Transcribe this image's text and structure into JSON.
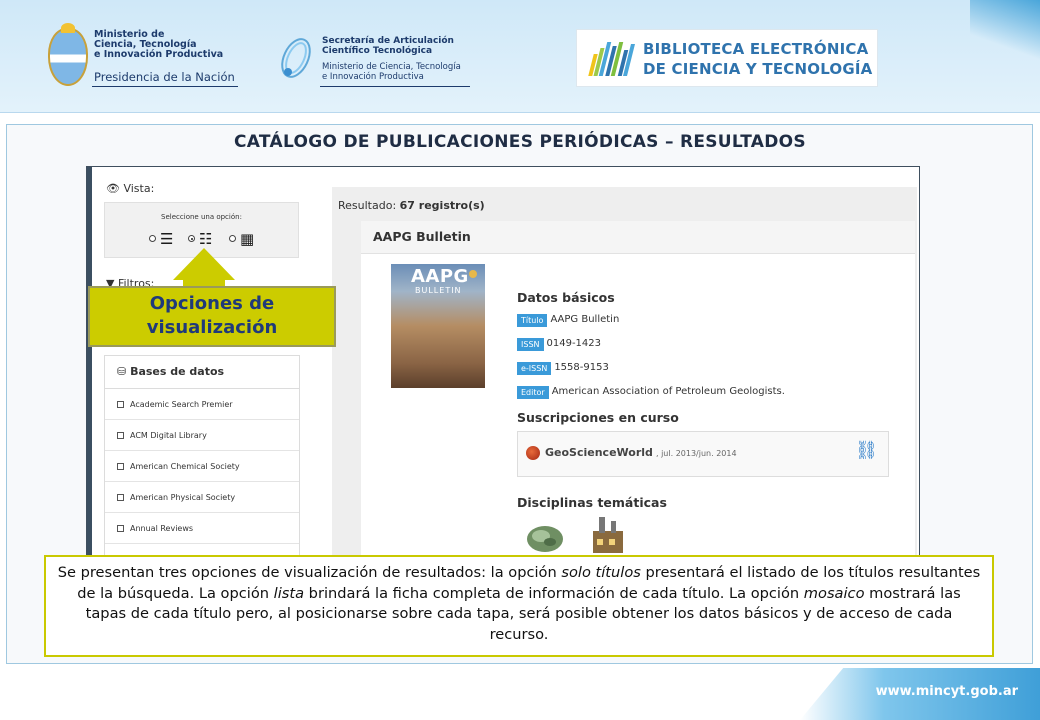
{
  "header": {
    "ministerio": {
      "line1": "Ministerio de",
      "line2": "Ciencia, Tecnología",
      "line3": "e Innovación Productiva",
      "line4": "Presidencia de la Nación"
    },
    "secretaria": {
      "line1": "Secretaría de Articulación",
      "line2": "Científico Tecnológica",
      "line3": "Ministerio de Ciencia, Tecnología",
      "line4": "e Innovación Productiva"
    },
    "biblioteca": {
      "line1": "BIBLIOTECA ELECTRÓNICA",
      "line2": "DE CIENCIA Y TECNOLOGÍA"
    }
  },
  "page_title": "CATÁLOGO DE PUBLICACIONES PERIÓDICAS – RESULTADOS",
  "sidebar": {
    "vista_label": "Vista:",
    "option_title": "Seleccione una opción:",
    "options": [
      {
        "name": "solo-titulos",
        "glyph": "☰",
        "selected": false
      },
      {
        "name": "lista",
        "glyph": "☷",
        "selected": true
      },
      {
        "name": "mosaico",
        "glyph": "▦",
        "selected": false
      }
    ],
    "filtros_label": "Filtros:",
    "db_header": "Bases de datos",
    "databases": [
      "Academic Search Premier",
      "ACM Digital Library",
      "American Chemical Society",
      "American Physical Society",
      "Annual Reviews"
    ]
  },
  "results": {
    "prefix": "Resultado:",
    "count": "67 registro(s)",
    "card_title": "AAPG Bulletin",
    "cover": {
      "title": "AAPG",
      "subtitle": "BULLETIN"
    },
    "datos_basicos_title": "Datos básicos",
    "fields": [
      {
        "label": "Título",
        "value": "AAPG Bulletin"
      },
      {
        "label": "ISSN",
        "value": "0149-1423"
      },
      {
        "label": "e-ISSN",
        "value": "1558-9153"
      },
      {
        "label": "Editor",
        "value": "American Association of Petroleum Geologists."
      }
    ],
    "suscripciones_title": "Suscripciones en curso",
    "subscription": {
      "name": "GeoScienceWorld",
      "dates": ", jul. 2013/jun. 2014"
    },
    "disciplinas_title": "Disciplinas temáticas"
  },
  "callout": {
    "line1": "Opciones de",
    "line2": "visualización",
    "color": "#cccc00"
  },
  "description": {
    "part1": "Se presentan tres opciones de visualización de resultados: la opción ",
    "em1": "solo títulos",
    "part2": " presentará el listado de los títulos resultantes de la búsqueda. La opción ",
    "em2": "lista",
    "part3": " brindará la ficha completa de información de cada título. La opción ",
    "em3": "mosaico",
    "part4": " mostrará las tapas de cada título pero, al posicionarse sobre cada tapa, será posible obtener los datos básicos y de acceso de cada recurso."
  },
  "footer": {
    "url": "www.mincyt.gob.ar"
  },
  "colors": {
    "accent_blue": "#3a9ad9",
    "title_navy": "#1f2d44",
    "callout_yellow": "#cccc00"
  }
}
